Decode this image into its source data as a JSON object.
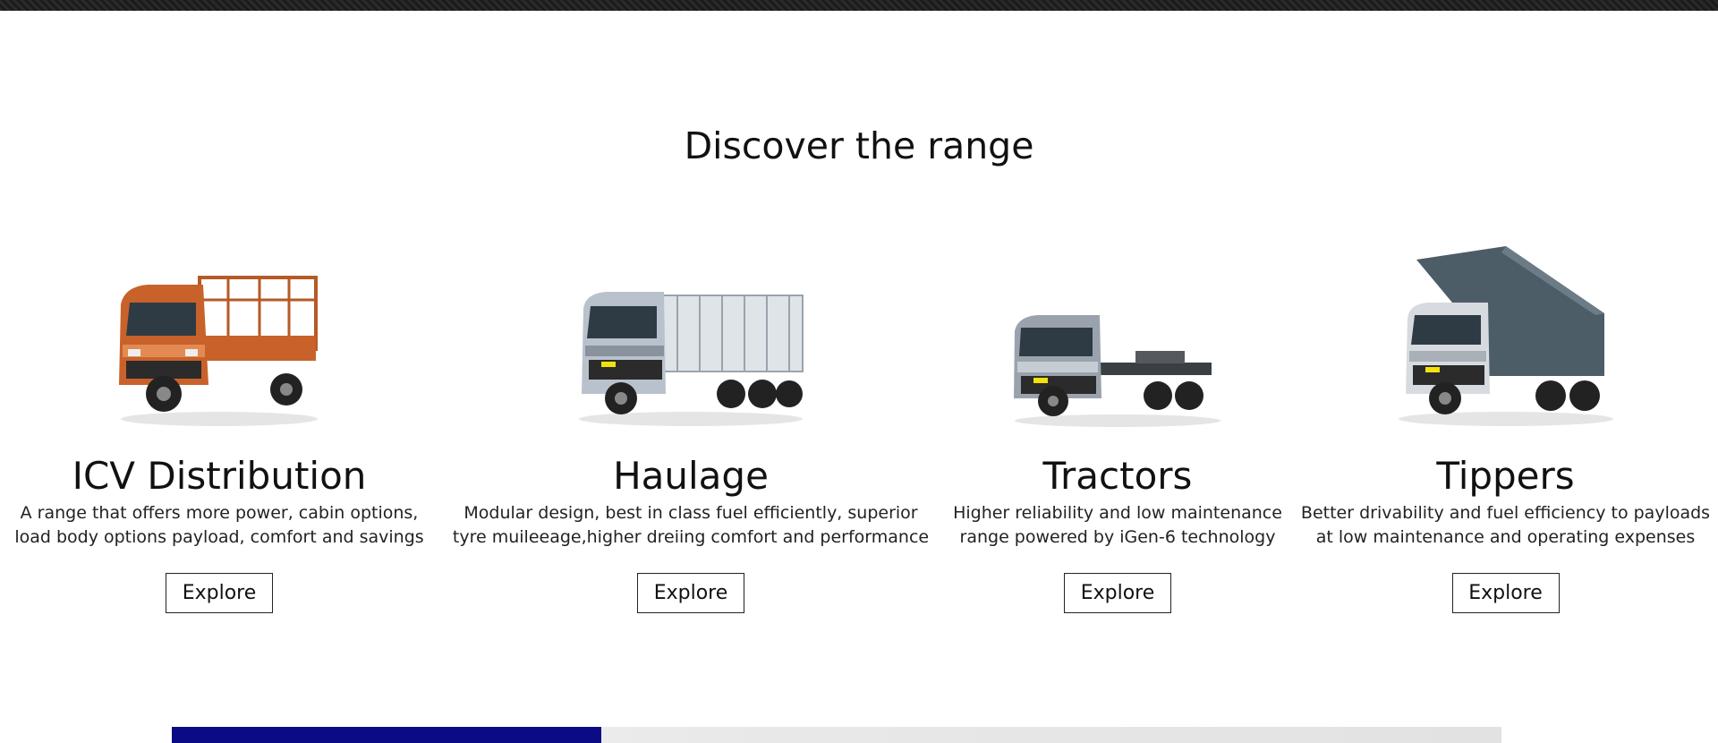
{
  "section": {
    "title": "Discover the range"
  },
  "cards": [
    {
      "title": "ICV Distribution",
      "description": "A range that offers more power, cabin options, load body options payload, comfort and savings",
      "button": "Explore"
    },
    {
      "title": "Haulage",
      "description": "Modular design, best in class fuel efficiently, superior tyre muileeage,higher dreiing comfort and performance",
      "button": "Explore"
    },
    {
      "title": "Tractors",
      "description": "Higher reliability and low maintenance range powered by iGen-6 technology",
      "button": "Explore"
    },
    {
      "title": "Tippers",
      "description": "Better drivability and fuel efficiency to payloads at low maintenance and operating expenses",
      "button": "Explore"
    }
  ],
  "colors": {
    "accent": "#0b0b86",
    "icv_body": "#c8622a",
    "haulage_body": "#b9c2cc",
    "tractor_body": "#9aa3ad",
    "tipper_bin": "#4c5d68"
  }
}
